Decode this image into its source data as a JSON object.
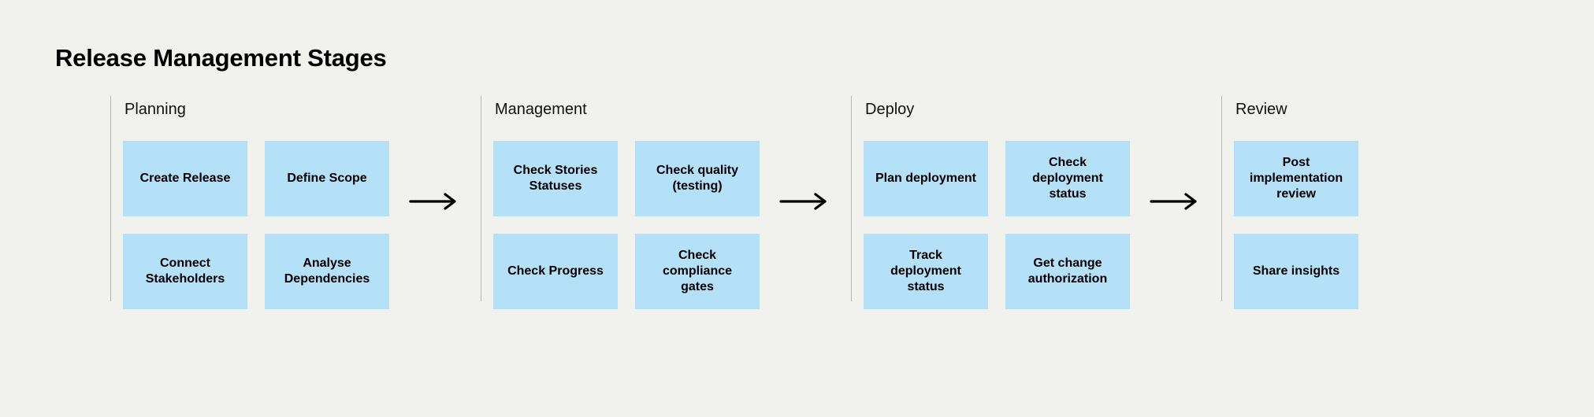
{
  "title": "Release Management Stages",
  "stages": [
    {
      "label": "Planning",
      "cards": [
        "Create Release",
        "Define Scope",
        "Connect Stakeholders",
        "Analyse Dependencies"
      ],
      "columns": 2
    },
    {
      "label": "Management",
      "cards": [
        "Check Stories Statuses",
        "Check quality (testing)",
        "Check Progress",
        "Check compliance gates"
      ],
      "columns": 2
    },
    {
      "label": "Deploy",
      "cards": [
        "Plan deployment",
        "Check deployment status",
        "Track deployment status",
        "Get change authorization"
      ],
      "columns": 2
    },
    {
      "label": "Review",
      "cards": [
        "Post implementation review",
        "Share insights"
      ],
      "columns": 1
    }
  ]
}
